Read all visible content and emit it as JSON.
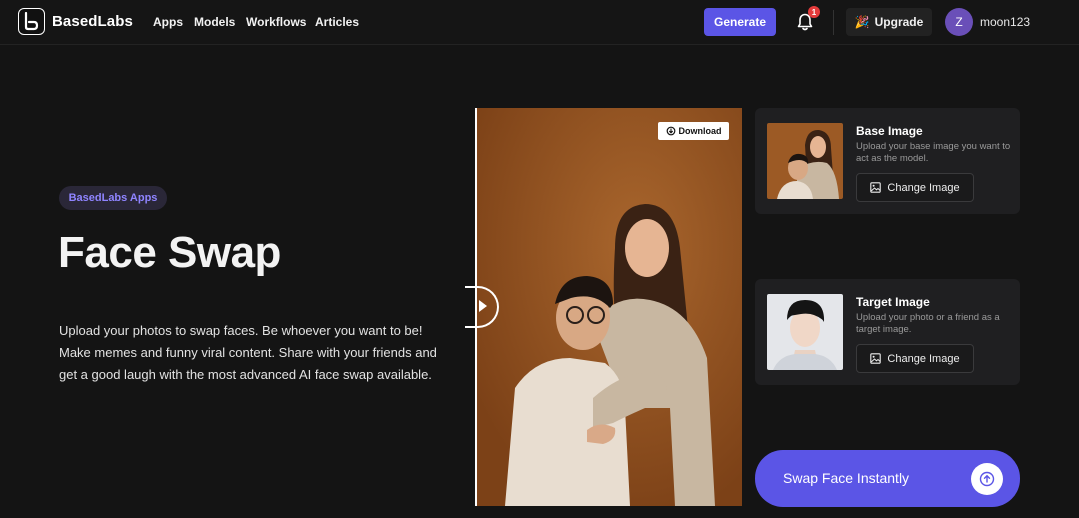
{
  "nav": {
    "logo_text": "BasedLabs",
    "links": [
      "Apps",
      "Models",
      "Workflows",
      "Articles"
    ],
    "generate_label": "Generate",
    "notification_count": "1",
    "upgrade_label": "Upgrade",
    "avatar_initial": "Z",
    "username": "moon123"
  },
  "hero": {
    "badge": "BasedLabs Apps",
    "title": "Face Swap",
    "description": "Upload your photos to swap faces. Be whoever you want to be! Make memes and funny viral content. Share with your friends and get a good laugh with the most advanced AI face swap available."
  },
  "preview": {
    "download_label": "Download"
  },
  "base_card": {
    "title": "Base Image",
    "description": "Upload your base image you want to act as the model.",
    "button_label": "Change Image"
  },
  "target_card": {
    "title": "Target Image",
    "description": "Upload your photo or a friend as a target image.",
    "button_label": "Change Image"
  },
  "swap_button": {
    "label": "Swap Face Instantly"
  },
  "colors": {
    "accent": "#5b55e6",
    "background": "#141414",
    "card": "#1f1f21",
    "badge_text": "#8f84ff"
  }
}
